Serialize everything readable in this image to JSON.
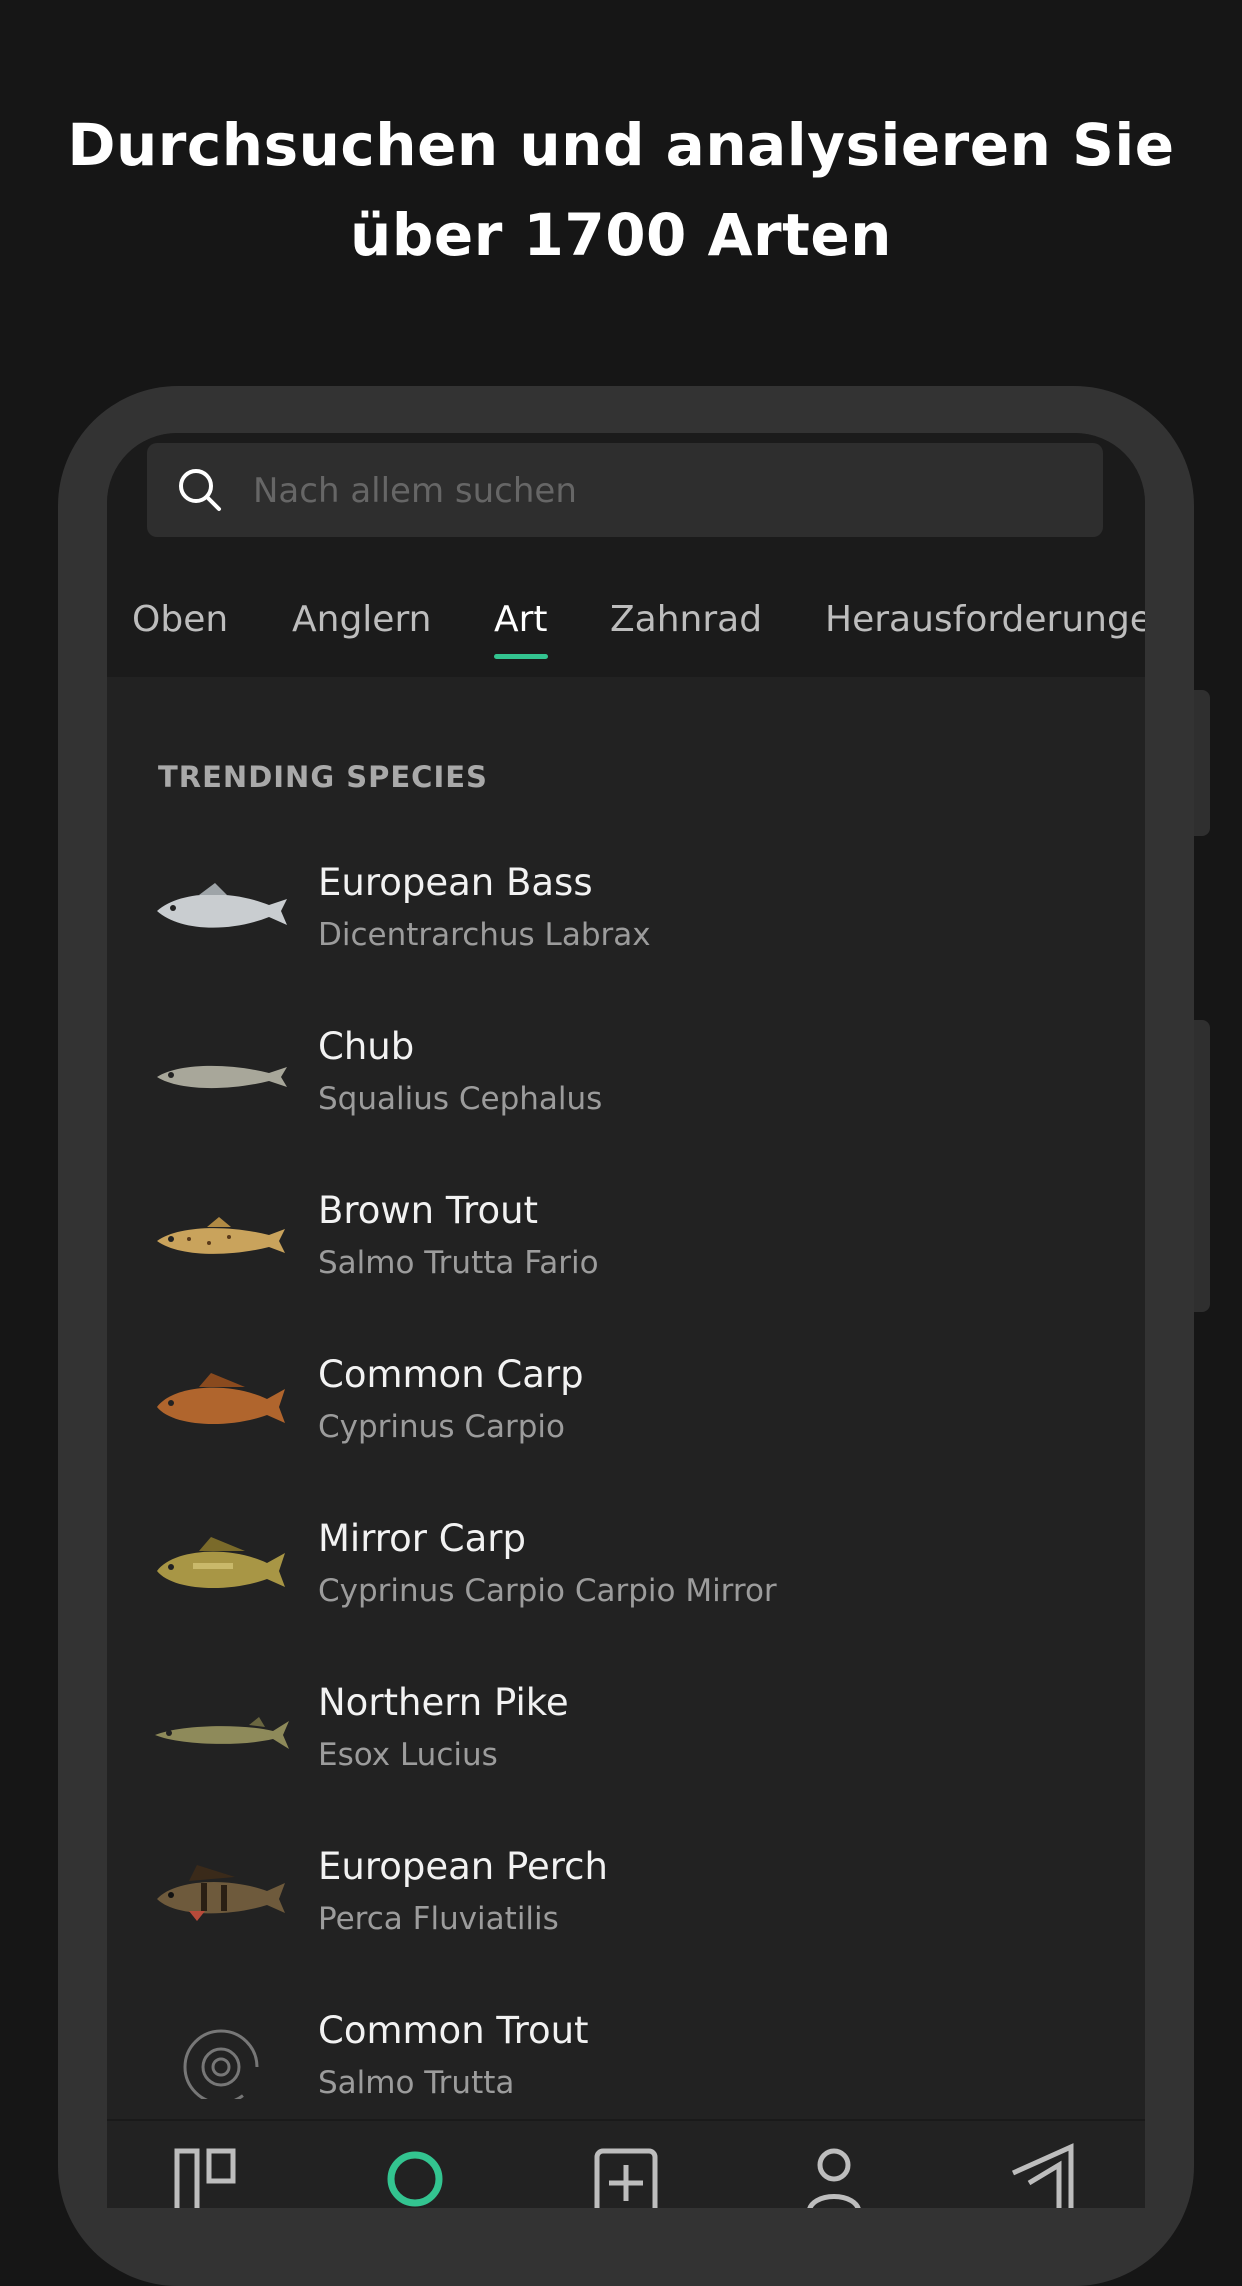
{
  "headline": {
    "line1": "Durchsuchen und analysieren Sie",
    "line2": "über 1700 Arten"
  },
  "search": {
    "placeholder": "Nach allem suchen",
    "icon": "search-icon"
  },
  "tabs": [
    {
      "label": "Oben",
      "active": false
    },
    {
      "label": "Anglern",
      "active": false
    },
    {
      "label": "Art",
      "active": true
    },
    {
      "label": "Zahnrad",
      "active": false
    },
    {
      "label": "Herausforderungen",
      "active": false
    }
  ],
  "section_title": "TRENDING SPECIES",
  "species": [
    {
      "name": "European Bass",
      "scientific": "Dicentrarchus Labrax",
      "color": "#c9cdd0"
    },
    {
      "name": "Chub",
      "scientific": "Squalius Cephalus",
      "color": "#a8a79a"
    },
    {
      "name": "Brown Trout",
      "scientific": "Salmo Trutta Fario",
      "color": "#c9a35c"
    },
    {
      "name": "Common Carp",
      "scientific": "Cyprinus Carpio",
      "color": "#b0652d"
    },
    {
      "name": "Mirror Carp",
      "scientific": "Cyprinus Carpio Carpio Mirror",
      "color": "#a89645"
    },
    {
      "name": "Northern Pike",
      "scientific": "Esox Lucius",
      "color": "#8e8a5a"
    },
    {
      "name": "European Perch",
      "scientific": "Perca Fluviatilis",
      "color": "#6e5a3c"
    },
    {
      "name": "Common Trout",
      "scientific": "Salmo Trutta",
      "color": "placeholder"
    }
  ],
  "bottom_nav": [
    {
      "icon": "feed-icon",
      "active": false
    },
    {
      "icon": "search-icon",
      "active": true
    },
    {
      "icon": "add-icon",
      "active": false
    },
    {
      "icon": "profile-icon",
      "active": false
    },
    {
      "icon": "map-icon",
      "active": false
    }
  ],
  "colors": {
    "accent": "#33c490",
    "background": "#161616",
    "screen": "#222222"
  }
}
